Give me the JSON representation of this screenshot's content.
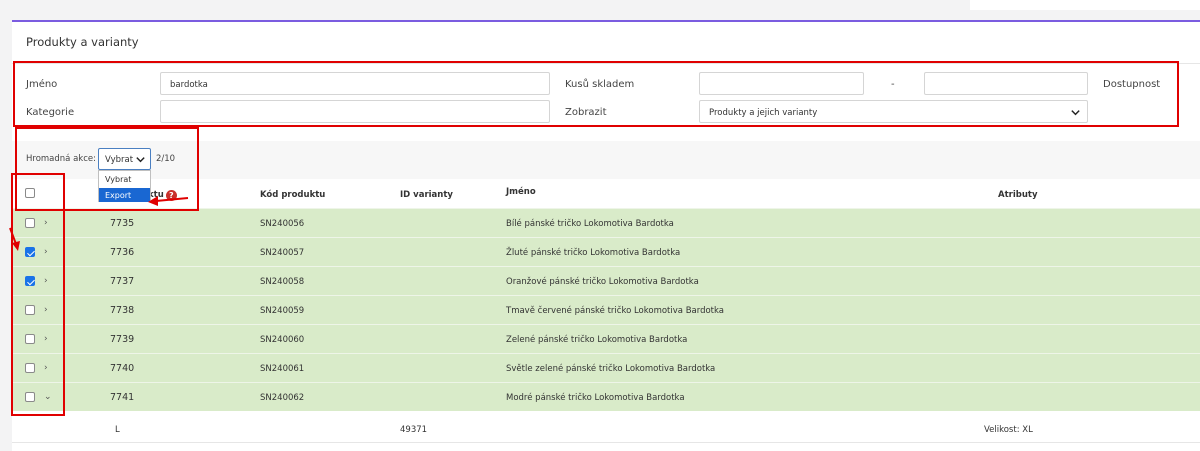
{
  "panel": {
    "title": "Produkty a varianty"
  },
  "filters": {
    "name_label": "Jméno",
    "name_value": "bardotka",
    "stock_label": "Kusů skladem",
    "stock_from": "",
    "stock_separator": "-",
    "stock_to": "",
    "availability_label": "Dostupnost",
    "category_label": "Kategorie",
    "category_value": "",
    "show_label": "Zobrazit",
    "show_value": "Produkty a jejich varianty"
  },
  "bulk": {
    "label": "Hromadná akce:",
    "selected": "Vybrat",
    "count": "2/10",
    "options": [
      "Vybrat",
      "Export"
    ]
  },
  "table": {
    "headers": {
      "product_id": "ktu",
      "product_code": "Kód produktu",
      "variant_id": "ID varianty",
      "name": "Jméno",
      "attributes": "Atributy"
    },
    "rows": [
      {
        "checked": false,
        "expanded": false,
        "id": "7735",
        "code": "SN240056",
        "name": "Bílé pánské tričko Lokomotiva Bardotka"
      },
      {
        "checked": true,
        "expanded": false,
        "id": "7736",
        "code": "SN240057",
        "name": "Žluté pánské tričko Lokomotiva Bardotka"
      },
      {
        "checked": true,
        "expanded": false,
        "id": "7737",
        "code": "SN240058",
        "name": "Oranžové pánské tričko Lokomotiva Bardotka"
      },
      {
        "checked": false,
        "expanded": false,
        "id": "7738",
        "code": "SN240059",
        "name": "Tmavě červené pánské tričko Lokomotiva Bardotka"
      },
      {
        "checked": false,
        "expanded": false,
        "id": "7739",
        "code": "SN240060",
        "name": "Zelené pánské tričko Lokomotiva Bardotka"
      },
      {
        "checked": false,
        "expanded": false,
        "id": "7740",
        "code": "SN240061",
        "name": "Světle zelené pánské tričko Lokomotiva Bardotka"
      },
      {
        "checked": false,
        "expanded": true,
        "id": "7741",
        "code": "SN240062",
        "name": "Modré pánské tričko Lokomotiva Bardotka"
      }
    ],
    "variant": {
      "marker": "L",
      "variant_id": "49371",
      "attribute": "Velikost: XL"
    }
  },
  "colors": {
    "accent": "#7b5ce0",
    "row_bg": "#d9ebc9",
    "highlight": "#e00000",
    "selected_option": "#1967d2"
  }
}
